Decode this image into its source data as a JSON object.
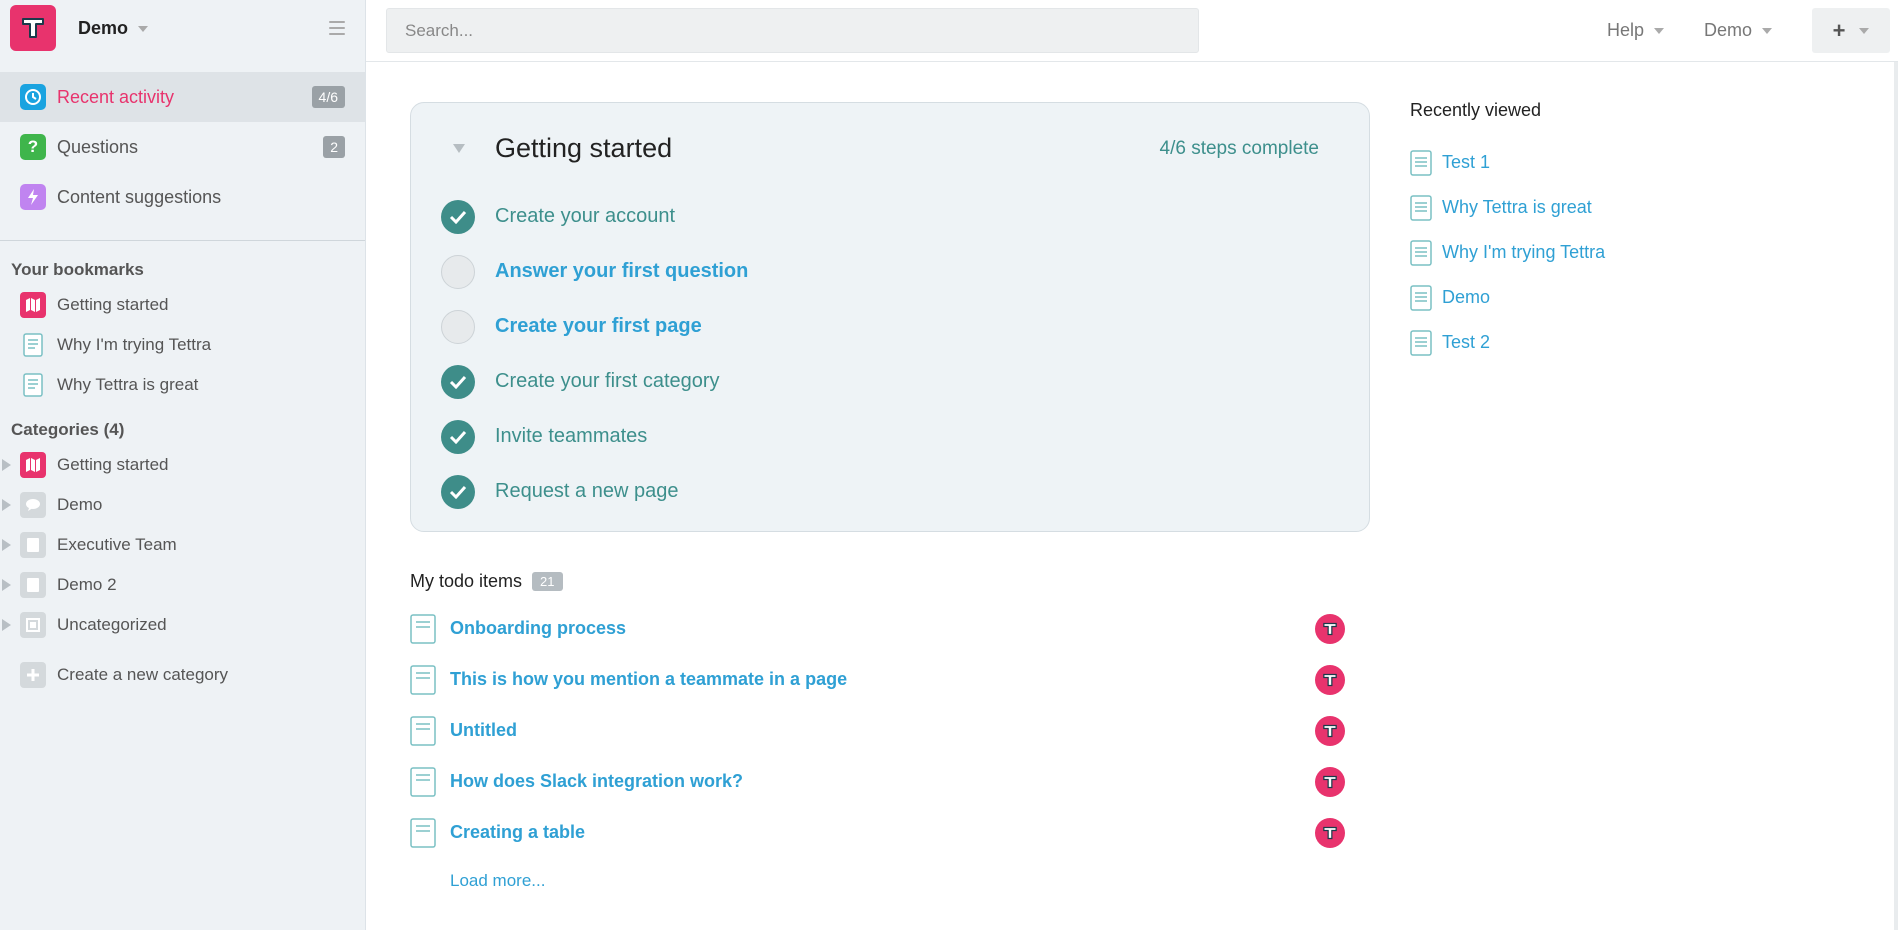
{
  "workspace": {
    "name": "Demo"
  },
  "sidebar": {
    "nav": [
      {
        "label": "Recent activity",
        "badge": "4/6",
        "icon": "clock-icon",
        "color": "#1aa3e0",
        "active": true
      },
      {
        "label": "Questions",
        "badge": "2",
        "icon": "question-icon",
        "color": "#3fb54b"
      },
      {
        "label": "Content suggestions",
        "badge": "",
        "icon": "lightning-icon",
        "color": "#c084f0"
      }
    ],
    "bookmarks_title": "Your bookmarks",
    "bookmarks": [
      {
        "label": "Getting started",
        "icon": "map-icon"
      },
      {
        "label": "Why I'm trying Tettra",
        "icon": "document-icon"
      },
      {
        "label": "Why Tettra is great",
        "icon": "document-icon"
      }
    ],
    "categories_title": "Categories (4)",
    "categories": [
      {
        "label": "Getting started",
        "icon": "map-icon"
      },
      {
        "label": "Demo",
        "icon": "chat-icon"
      },
      {
        "label": "Executive Team",
        "icon": "book-icon"
      },
      {
        "label": "Demo 2",
        "icon": "book-icon"
      },
      {
        "label": "Uncategorized",
        "icon": "box-icon"
      }
    ],
    "create_category": "Create a new category"
  },
  "topbar": {
    "search_placeholder": "Search...",
    "help": "Help",
    "account": "Demo",
    "plus": "+"
  },
  "getting_started": {
    "title": "Getting started",
    "progress": "4/6 steps complete",
    "steps": [
      {
        "label": "Create your account",
        "done": true
      },
      {
        "label": "Answer your first question",
        "done": false
      },
      {
        "label": "Create your first page",
        "done": false
      },
      {
        "label": "Create your first category",
        "done": true
      },
      {
        "label": "Invite teammates",
        "done": true
      },
      {
        "label": "Request a new page",
        "done": true
      }
    ]
  },
  "todo": {
    "title": "My todo items",
    "count": "21",
    "items": [
      "Onboarding process",
      "This is how you mention a teammate in a page",
      "Untitled",
      "How does Slack integration work?",
      "Creating a table"
    ],
    "load_more": "Load more..."
  },
  "recently_viewed": {
    "title": "Recently viewed",
    "items": [
      "Test 1",
      "Why Tettra is great",
      "Why I'm trying Tettra",
      "Demo",
      "Test 2"
    ]
  },
  "colors": {
    "brand": "#e8336d",
    "link": "#2fa0d4",
    "teal": "#3d8f8c"
  }
}
